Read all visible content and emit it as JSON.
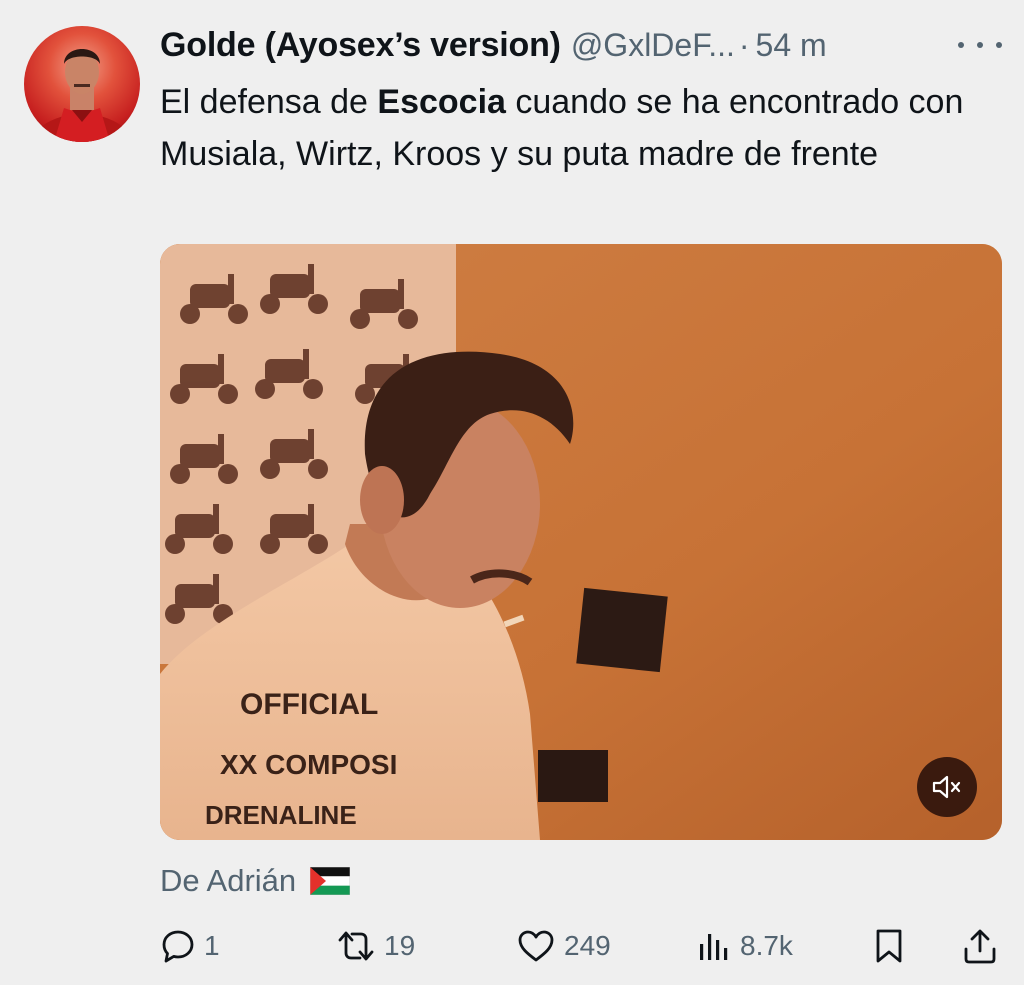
{
  "tweet": {
    "author": {
      "display_name": "Golde (Ayosex’s version)",
      "handle": "@GxlDeF...",
      "separator": "·",
      "time": "54 m"
    },
    "text": {
      "part1": "El defensa de ",
      "bold": "Escocia",
      "part2": " cuando se ha encontrado con Musiala, Wirtz, Kroos y su puta madre de frente"
    },
    "media": {
      "shirt_text_1": "OFFICIAL",
      "shirt_text_2": "XX COMPOSI",
      "shirt_text_3": "DRENALINE",
      "mute_icon": "speaker-muted-icon"
    },
    "source": {
      "label": "De Adrián",
      "flag_icon": "palestine-flag-icon"
    },
    "actions": {
      "reply_count": "1",
      "retweet_count": "19",
      "like_count": "249",
      "views_count": "8.7k"
    }
  },
  "colors": {
    "background": "#efefef",
    "text_primary": "#0f1419",
    "text_secondary": "#536471",
    "media_wall": "#c8773d"
  }
}
